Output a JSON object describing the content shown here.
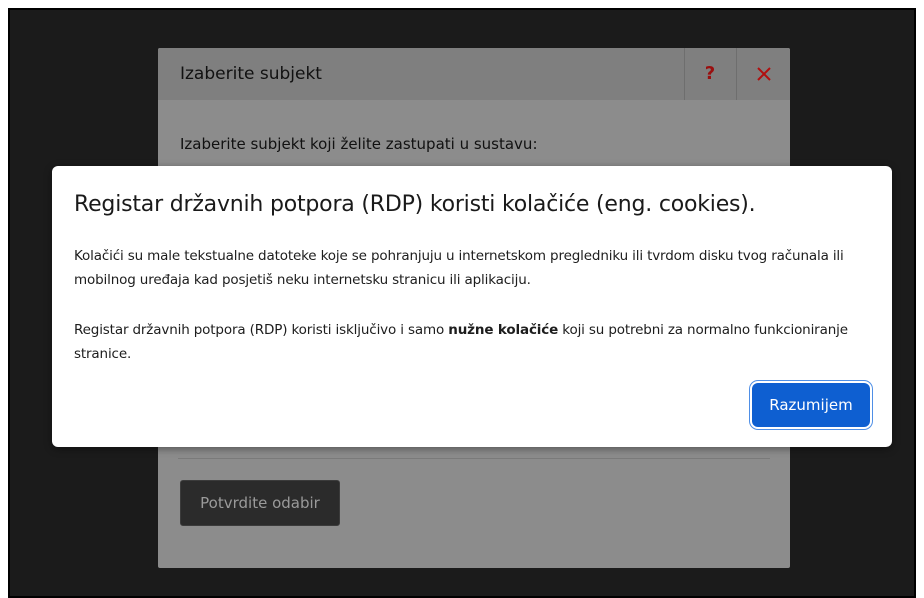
{
  "subject_dialog": {
    "title": "Izaberite subjekt",
    "help_label": "?",
    "prompt": "Izaberite subjekt koji želite zastupati u sustavu:",
    "confirm_label": "Potvrdite odabir"
  },
  "cookie_banner": {
    "title": "Registar državnih potpora (RDP) koristi kolačiće (eng. cookies).",
    "paragraph1": "Kolačići su male tekstualne datoteke koje se pohranjuju u internetskom pregledniku ili tvrdom disku tvog računala ili mobilnog uređaja kad posjetiš neku internetsku stranicu ili aplikaciju.",
    "paragraph2_before": "Registar državnih potpora (RDP) koristi isključivo i samo ",
    "paragraph2_bold": "nužne kolačiće",
    "paragraph2_after": " koji su potrebni za normalno funkcioniranje stranice.",
    "accept_label": "Razumijem"
  },
  "colors": {
    "backdrop": "#1b1b1b",
    "accent": "#0e5fd1",
    "close_icon": "#b10f0f"
  },
  "icons": {
    "help": "help-icon",
    "close": "close-icon"
  }
}
